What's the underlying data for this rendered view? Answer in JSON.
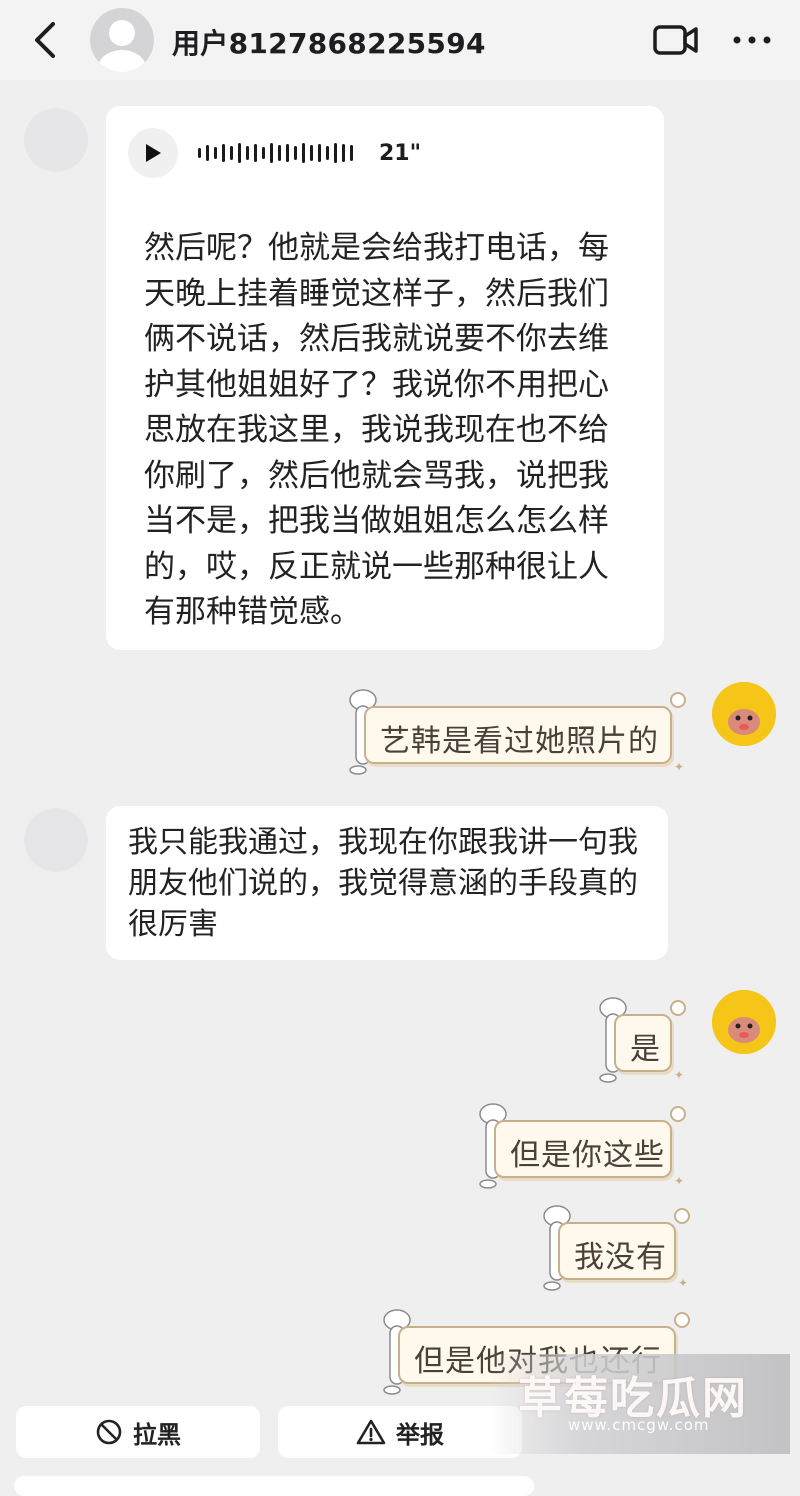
{
  "header": {
    "username": "用户8127868225594",
    "icons": [
      "back-arrow-icon",
      "avatar-placeholder-icon",
      "video-call-icon",
      "more-dots-icon"
    ]
  },
  "voice_message": {
    "duration": "21\"",
    "transcript": "然后呢？他就是会给我打电话，每天晚上挂着睡觉这样子，然后我们俩不说话，然后我就说要不你去维护其他姐姐好了？我说你不用把心思放在我这里，我说我现在也不给你刷了，然后他就会骂我，说把我当不是，把我当做姐姐怎么怎么样的，哎，反正就说一些那种很让人有那种错觉感。"
  },
  "messages": [
    {
      "side": "right",
      "type": "sticker",
      "text": "艺韩是看过她照片的"
    },
    {
      "side": "left",
      "type": "text",
      "text": "我只能我通过，我现在你跟我讲一句我朋友他们说的，我觉得意涵的手段真的很厉害"
    },
    {
      "side": "right",
      "type": "sticker",
      "text": "是"
    },
    {
      "side": "right",
      "type": "sticker",
      "text": "但是你这些"
    },
    {
      "side": "right",
      "type": "sticker",
      "text": "我没有"
    },
    {
      "side": "right",
      "type": "sticker",
      "text": "但是他对我也还行"
    }
  ],
  "bottom_actions": {
    "block_label": "拉黑",
    "report_label": "举报"
  },
  "watermark": {
    "title": "草莓吃瓜网",
    "url": "www.cmcgw.com"
  },
  "colors": {
    "background": "#efeff0",
    "bubble": "#ffffff",
    "sticker_border": "#c9b08c",
    "self_avatar": "#f5c518"
  }
}
